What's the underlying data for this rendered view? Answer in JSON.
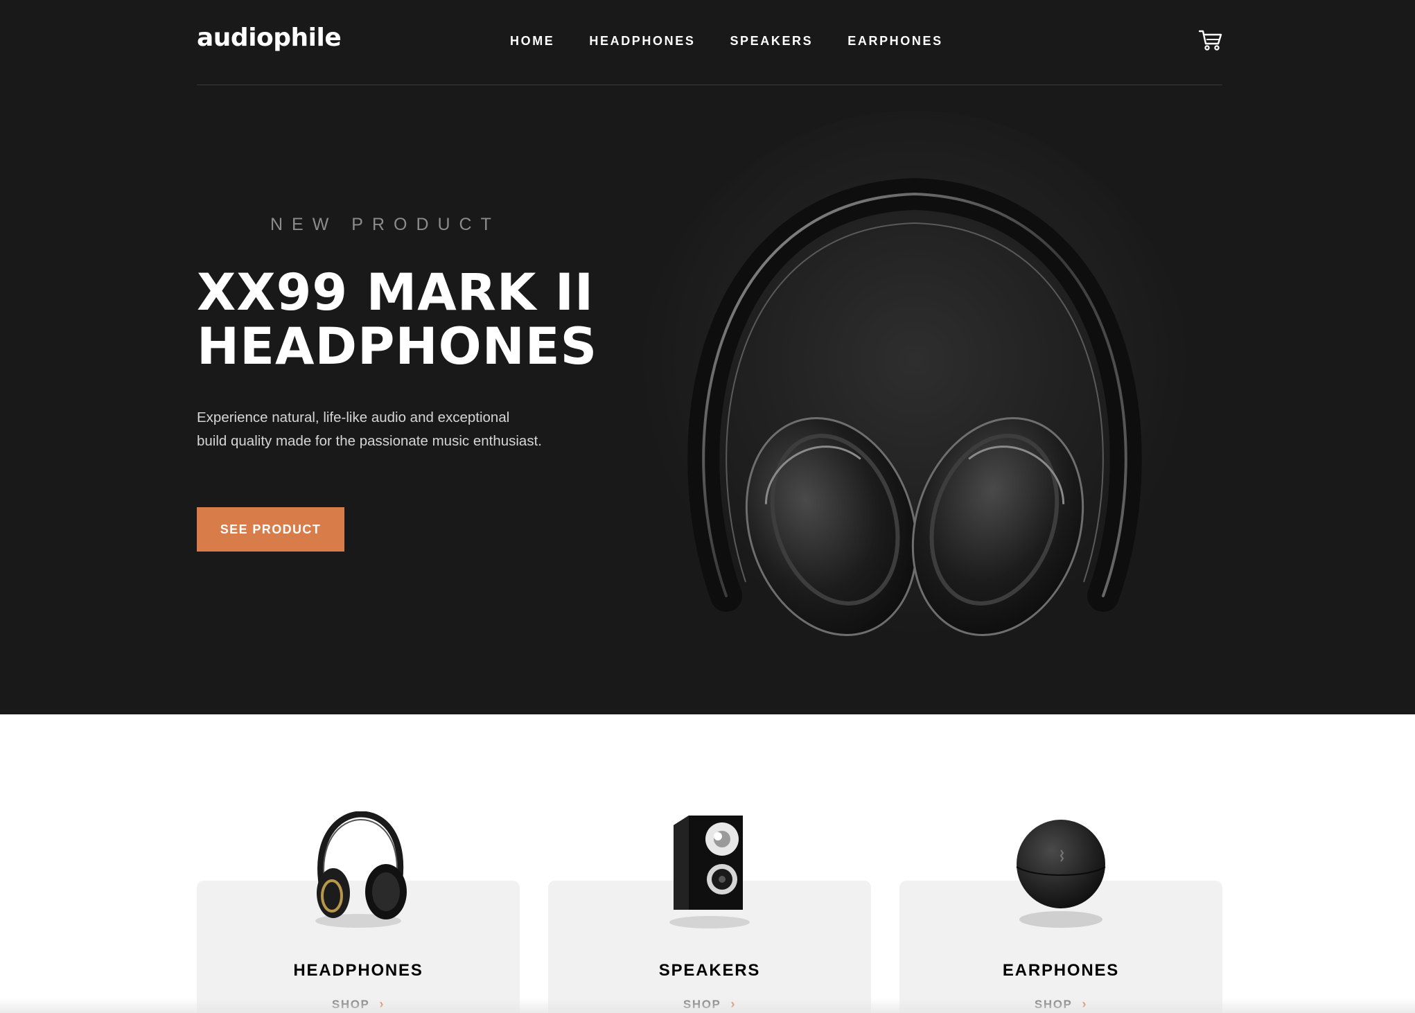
{
  "header": {
    "logo": "audiophile",
    "nav": [
      {
        "label": "HOME"
      },
      {
        "label": "HEADPHONES"
      },
      {
        "label": "SPEAKERS"
      },
      {
        "label": "EARPHONES"
      }
    ],
    "cart_icon": "cart-icon"
  },
  "hero": {
    "overline": "NEW PRODUCT",
    "title": "XX99 MARK II HEADPHONES",
    "description": "Experience natural, life-like audio and exceptional build quality made for the passionate music enthusiast.",
    "cta_label": "SEE PRODUCT",
    "image": "headphones-hero-image"
  },
  "categories": [
    {
      "title": "HEADPHONES",
      "shop_label": "SHOP",
      "image": "headphones-thumbnail"
    },
    {
      "title": "SPEAKERS",
      "shop_label": "SHOP",
      "image": "speaker-thumbnail"
    },
    {
      "title": "EARPHONES",
      "shop_label": "SHOP",
      "image": "earphones-case-thumbnail"
    }
  ],
  "colors": {
    "accent": "#D87D4A",
    "hero_background": "#191919",
    "card_background": "#F1F1F1"
  }
}
